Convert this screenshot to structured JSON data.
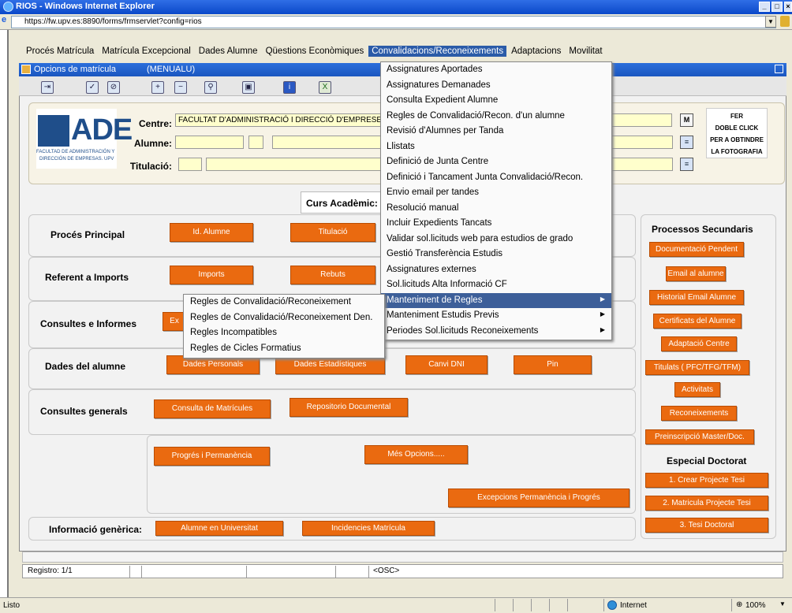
{
  "browser": {
    "title": "RIOS - Windows Internet Explorer",
    "url": "https://fw.upv.es:8890/forms/frmservlet?config=rios",
    "status_left": "Listo",
    "zone": "Internet",
    "zoom": "100%"
  },
  "menubar": {
    "items": [
      {
        "label": "Procés Matrícula"
      },
      {
        "label": "Matrícula Excepcional"
      },
      {
        "label": "Dades Alumne"
      },
      {
        "label": "Qüestions Econòmiques"
      },
      {
        "label": "Convalidacions/Reconeixements"
      },
      {
        "label": "Adaptacions"
      },
      {
        "label": "Movilitat"
      }
    ]
  },
  "window": {
    "title": "Opcions de matrícula",
    "subtitle": "(MENUALU)"
  },
  "header": {
    "logo_text": "ADE",
    "logo_sub1": "FACULTAD DE ADMINISTRACIÓN Y",
    "logo_sub2": "DIRECCIÓN DE EMPRESAS. UPV",
    "centre_label": "Centre:",
    "centre_value": "FACULTAT D'ADMINISTRACIÓ I DIRECCIÓ D'EMPRESES",
    "alumne_label": "Alumne:",
    "titulacio_label": "Titulació:",
    "m_button": "M",
    "foto_line1": "FER",
    "foto_line2": "DOBLE CLICK",
    "foto_line3": "PER A OBTINDRE",
    "foto_line4": "LA FOTOGRAFIA",
    "curs_label": "Curs Acadèmic:"
  },
  "sections": {
    "proces_principal": {
      "label": "Procés Principal",
      "buttons": [
        "Id. Alumne",
        "Titulació"
      ]
    },
    "referent_imports": {
      "label": "Referent a Imports",
      "buttons": [
        "Imports",
        "Rebuts"
      ]
    },
    "consultes_informes": {
      "label": "Consultes e Informes",
      "buttons": [
        "Ex"
      ]
    },
    "dades_alumne": {
      "label": "Dades del alumne",
      "buttons": [
        "Dades Personals",
        "Dades Estadístiques",
        "Canvi DNI",
        "Pin"
      ]
    },
    "consultes_generals": {
      "label": "Consultes generals",
      "buttons": [
        "Consulta de Matrícules",
        "Repositorio Documental"
      ]
    },
    "extra": {
      "buttons": [
        "Progrés i Permanència",
        "Més Opcions.....",
        "Excepcions Permanència i Progrés"
      ]
    },
    "informacio_generica": {
      "label": "Informació genèrica:",
      "buttons": [
        "Alumne en Universitat",
        "Incidencies Matrícula"
      ]
    }
  },
  "right_panel": {
    "title": "Processos Secundaris",
    "buttons": [
      "Documentació Pendent",
      "Email al alumne",
      "Historial Email Alumne",
      "Certificats del Alumne",
      "Adaptació Centre",
      "Titulats ( PFC/TFG/TFM)",
      "Activitats",
      "Reconeixements",
      "Preinscripció Master/Doc."
    ],
    "doctorat_title": "Especial  Doctorat",
    "doctorat_buttons": [
      "1. Crear Projecte Tesi",
      "2. Matricula Projecte Tesi",
      "3. Tesi Doctoral"
    ]
  },
  "dropdown": {
    "items": [
      {
        "label": "Assignatures Aportades"
      },
      {
        "label": "Assignatures Demanades"
      },
      {
        "label": "Consulta Expedient Alumne"
      },
      {
        "label": "Regles de Convalidació/Recon. d'un alumne"
      },
      {
        "label": "Revisió d'Alumnes per Tanda"
      },
      {
        "label": "Llistats"
      },
      {
        "label": "Definició de Junta Centre"
      },
      {
        "label": "Definició i Tancament Junta Convalidació/Recon."
      },
      {
        "label": "Envio email per tandes"
      },
      {
        "label": "Resolució manual"
      },
      {
        "label": "Incluir Expedients Tancats"
      },
      {
        "label": "Validar sol.licituds web para estudios de grado"
      },
      {
        "label": "Gestió Transferència Estudis"
      },
      {
        "label": "Assignatures externes"
      },
      {
        "label": "Sol.licituds Alta Informació CF"
      },
      {
        "label": "Manteniment de Regles"
      },
      {
        "label": "Manteniment Estudis Previs"
      },
      {
        "label": "Periodes Sol.licituds Reconeixements"
      }
    ]
  },
  "submenu": {
    "items": [
      {
        "label": "Regles de Convalidació/Reconeixement"
      },
      {
        "label": "Regles de Convalidació/Reconeixement Den."
      },
      {
        "label": "Regles Incompatibles"
      },
      {
        "label": "Regles de Cicles Formatius"
      }
    ]
  },
  "statusbar": {
    "registro": "Registro: 1/1",
    "osc": "<OSC>"
  }
}
